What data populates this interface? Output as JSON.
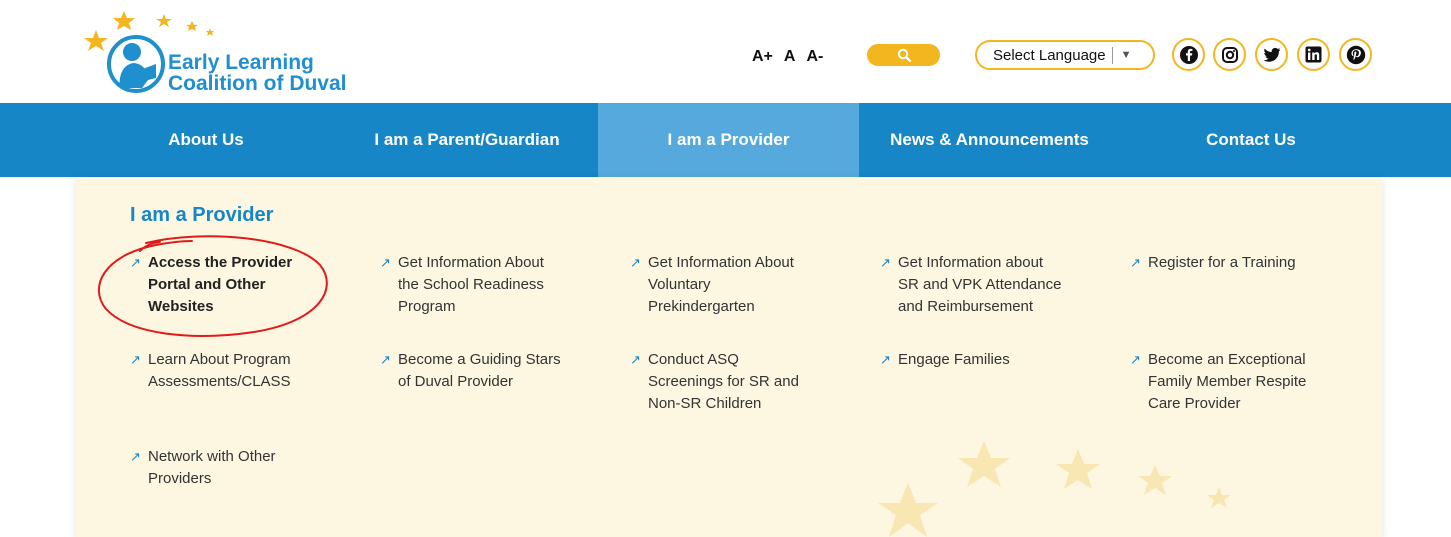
{
  "header": {
    "logo": {
      "line1": "Early Learning",
      "line2": "Coalition of Duval",
      "icon": "child-reading-logo-icon"
    },
    "font_size": {
      "increase": "A+",
      "normal": "A",
      "decrease": "A-"
    },
    "search": {
      "icon": "search-icon"
    },
    "language": {
      "label": "Select Language",
      "arrow": "▼"
    },
    "social": [
      "facebook-icon",
      "instagram-icon",
      "twitter-icon",
      "linkedin-icon",
      "pinterest-icon"
    ]
  },
  "nav": {
    "items": [
      {
        "label": "About Us"
      },
      {
        "label": "I am a Parent/Guardian"
      },
      {
        "label": "I am a Provider",
        "active": true
      },
      {
        "label": "News & Announcements"
      },
      {
        "label": "Contact Us"
      }
    ]
  },
  "dropdown": {
    "title": "I am a Provider",
    "links": [
      [
        "Access the Provider",
        "Portal and Other",
        "Websites"
      ],
      [
        "Get Information About",
        "the School Readiness",
        "Program"
      ],
      [
        "Get Information About",
        "Voluntary",
        "Prekindergarten"
      ],
      [
        "Get Information about",
        "SR and VPK Attendance",
        "and Reimbursement"
      ],
      [
        "Register for a Training"
      ],
      [
        "Learn About Program",
        "Assessments/CLASS"
      ],
      [
        "Become a Guiding Stars",
        "of Duval Provider"
      ],
      [
        "Conduct ASQ",
        "Screenings for SR and",
        "Non-SR Children"
      ],
      [
        "Engage Families"
      ],
      [
        "Become an Exceptional",
        "Family Member Respite",
        "Care Provider"
      ],
      [
        "Network with Other",
        "Providers"
      ]
    ],
    "arrow": "↗"
  },
  "colors": {
    "brand_blue": "#1686c7",
    "active_nav": "#56a9dc",
    "gold": "#f3b61f",
    "panel": "#fdf6e1",
    "annotation_red": "#e01b1b"
  }
}
